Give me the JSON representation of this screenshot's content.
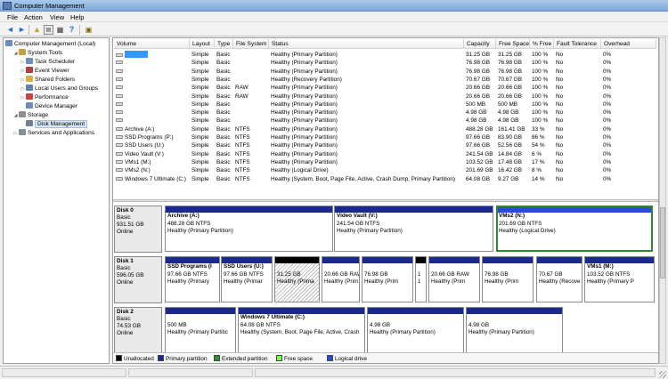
{
  "window": {
    "title": "Computer Management"
  },
  "menu": [
    "File",
    "Action",
    "View",
    "Help"
  ],
  "toolbar": {
    "icons": [
      "back-arrow-icon",
      "forward-arrow-icon",
      "up-folder-icon",
      "show-hide-tree-icon",
      "help-icon",
      "properties-icon",
      "panel-icon"
    ]
  },
  "tree": {
    "root": "Computer Management (Local)",
    "items": [
      {
        "label": "System Tools",
        "level": 1,
        "expand": "◢",
        "icon": "#c8a040"
      },
      {
        "label": "Task Scheduler",
        "level": 2,
        "expand": "▷",
        "icon": "#7090b8"
      },
      {
        "label": "Event Viewer",
        "level": 2,
        "expand": "▷",
        "icon": "#b04040"
      },
      {
        "label": "Shared Folders",
        "level": 2,
        "expand": "▷",
        "icon": "#d8b040"
      },
      {
        "label": "Local Users and Groups",
        "level": 2,
        "expand": "▷",
        "icon": "#6080b0"
      },
      {
        "label": "Performance",
        "level": 2,
        "expand": "▷",
        "icon": "#d04040"
      },
      {
        "label": "Device Manager",
        "level": 2,
        "expand": "",
        "icon": "#6a8cc0"
      },
      {
        "label": "Storage",
        "level": 1,
        "expand": "◢",
        "icon": "#909090"
      },
      {
        "label": "Disk Management",
        "level": 2,
        "expand": "",
        "icon": "#708090",
        "selected": true
      },
      {
        "label": "Services and Applications",
        "level": 1,
        "expand": "▷",
        "icon": "#8090a0"
      }
    ]
  },
  "volume_list": {
    "columns": [
      "Volume",
      "Layout",
      "Type",
      "File System",
      "Status",
      "Capacity",
      "Free Space",
      "% Free",
      "Fault Tolerance",
      "Overhead"
    ],
    "rows": [
      [
        "",
        "Simple",
        "Basic",
        "",
        "Healthy (Primary Partition)",
        "31.25 GB",
        "31.25 GB",
        "100 %",
        "No",
        "0%"
      ],
      [
        "",
        "Simple",
        "Basic",
        "",
        "Healthy (Primary Partition)",
        "76.98 GB",
        "76.98 GB",
        "100 %",
        "No",
        "0%"
      ],
      [
        "",
        "Simple",
        "Basic",
        "",
        "Healthy (Primary Partition)",
        "76.98 GB",
        "76.98 GB",
        "100 %",
        "No",
        "0%"
      ],
      [
        "",
        "Simple",
        "Basic",
        "",
        "Healthy (Recovery Partition)",
        "70.67 GB",
        "70.67 GB",
        "100 %",
        "No",
        "0%"
      ],
      [
        "",
        "Simple",
        "Basic",
        "RAW",
        "Healthy (Primary Partition)",
        "20.66 GB",
        "20.66 GB",
        "100 %",
        "No",
        "0%"
      ],
      [
        "",
        "Simple",
        "Basic",
        "RAW",
        "Healthy (Primary Partition)",
        "20.66 GB",
        "20.66 GB",
        "100 %",
        "No",
        "0%"
      ],
      [
        "",
        "Simple",
        "Basic",
        "",
        "Healthy (Primary Partition)",
        "500 MB",
        "500 MB",
        "100 %",
        "No",
        "0%"
      ],
      [
        "",
        "Simple",
        "Basic",
        "",
        "Healthy (Primary Partition)",
        "4.98 GB",
        "4.98 GB",
        "100 %",
        "No",
        "0%"
      ],
      [
        "",
        "Simple",
        "Basic",
        "",
        "Healthy (Primary Partition)",
        "4.98 GB",
        "4.98 GB",
        "100 %",
        "No",
        "0%"
      ],
      [
        "Archive (A:)",
        "Simple",
        "Basic",
        "NTFS",
        "Healthy (Primary Partition)",
        "488.28 GB",
        "161.41 GB",
        "33 %",
        "No",
        "0%"
      ],
      [
        "SSD Programs (P:)",
        "Simple",
        "Basic",
        "NTFS",
        "Healthy (Primary Partition)",
        "97.66 GB",
        "83.90 GB",
        "86 %",
        "No",
        "0%"
      ],
      [
        "SSD Users (U:)",
        "Simple",
        "Basic",
        "NTFS",
        "Healthy (Primary Partition)",
        "97.66 GB",
        "52.56 GB",
        "54 %",
        "No",
        "0%"
      ],
      [
        "Video Vault (V:)",
        "Simple",
        "Basic",
        "NTFS",
        "Healthy (Primary Partition)",
        "241.54 GB",
        "14.84 GB",
        "6 %",
        "No",
        "0%"
      ],
      [
        "VMs1 (M:)",
        "Simple",
        "Basic",
        "NTFS",
        "Healthy (Primary Partition)",
        "103.52 GB",
        "17.48 GB",
        "17 %",
        "No",
        "0%"
      ],
      [
        "VMs2 (N:)",
        "Simple",
        "Basic",
        "NTFS",
        "Healthy (Logical Drive)",
        "201.69 GB",
        "16.42 GB",
        "8 %",
        "No",
        "0%"
      ],
      [
        "Windows 7 Ultimate (C:)",
        "Simple",
        "Basic",
        "NTFS",
        "Healthy (System, Boot, Page File, Active, Crash Dump, Primary Partition)",
        "64.08 GB",
        "9.27 GB",
        "14 %",
        "No",
        "0%"
      ]
    ]
  },
  "disks": [
    {
      "name": "Disk 0",
      "type": "Basic",
      "size": "931.51 GB",
      "state": "Online",
      "partitions": [
        {
          "kind": "primary",
          "name": "Archive  (A:)",
          "size": "488.28 GB NTFS",
          "status": "Healthy (Primary Partition)"
        },
        {
          "kind": "primary",
          "name": "Video Vault  (V:)",
          "size": "241.54 GB NTFS",
          "status": "Healthy (Primary Partition)"
        },
        {
          "kind": "logical",
          "name": "VMs2  (N:)",
          "size": "201.69 GB NTFS",
          "status": "Healthy (Logical Drive)",
          "selected": true
        }
      ]
    },
    {
      "name": "Disk 1",
      "type": "Basic",
      "size": "596.05 GB",
      "state": "Online",
      "partitions": [
        {
          "kind": "primary",
          "name": "SSD Programs  (I",
          "size": "97.66 GB NTFS",
          "status": "Healthy (Primary"
        },
        {
          "kind": "primary",
          "name": "SSD Users  (U:)",
          "size": "97.66 GB NTFS",
          "status": "Healthy (Primar"
        },
        {
          "kind": "unalloc",
          "name": "",
          "size": "31.25 GB",
          "status": "Healthy (Prima"
        },
        {
          "kind": "primary",
          "name": "",
          "size": "20.66 GB RAW",
          "status": "Healthy (Prim"
        },
        {
          "kind": "primary",
          "name": "",
          "size": "76.98 GB",
          "status": "Healthy (Prim"
        },
        {
          "kind": "unallocbar",
          "name": "",
          "size": "1",
          "status": "1"
        },
        {
          "kind": "primary",
          "name": "",
          "size": "20.66 GB RAW",
          "status": "Healthy (Prim"
        },
        {
          "kind": "primary",
          "name": "",
          "size": "76.98 GB",
          "status": "Healthy (Prim"
        },
        {
          "kind": "primary",
          "name": "",
          "size": "70.67 GB",
          "status": "Healthy (Recove"
        },
        {
          "kind": "primary",
          "name": "VMs1  (M:)",
          "size": "103.52 GB NTFS",
          "status": "Healthy (Primary P"
        }
      ]
    },
    {
      "name": "Disk 2",
      "type": "Basic",
      "size": "74.53 GB",
      "state": "Online",
      "partitions": [
        {
          "kind": "primary",
          "name": "",
          "size": "500 MB",
          "status": "Healthy (Primary Partitic"
        },
        {
          "kind": "primary",
          "name": "Windows 7 Ultimate  (C:)",
          "size": "64.08 GB NTFS",
          "status": "Healthy (System, Boot, Page File, Active, Crash"
        },
        {
          "kind": "primary",
          "name": "",
          "size": "4.98 GB",
          "status": "Healthy (Primary Partition)"
        },
        {
          "kind": "primary",
          "name": "",
          "size": "4.98 GB",
          "status": "Healthy (Primary Partition)"
        }
      ]
    }
  ],
  "legend": [
    {
      "label": "Unallocated",
      "color": "#000000"
    },
    {
      "label": "Primary partition",
      "color": "#1a2a8c"
    },
    {
      "label": "Extended partition",
      "color": "#2e8b2e"
    },
    {
      "label": "Free space",
      "color": "#7cfc4c"
    },
    {
      "label": "Logical drive",
      "color": "#2a4ad8"
    }
  ],
  "colors": {
    "primary_bar": "#1a2a8c",
    "logical_bar": "#2a4ad8",
    "selection_outline": "#2b8a2b",
    "highlight_volume": "#3399ff"
  }
}
